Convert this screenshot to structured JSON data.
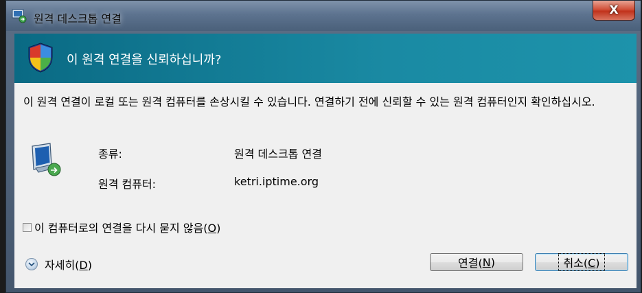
{
  "window": {
    "title": "원격 데스크톱 연결",
    "close_label": "X"
  },
  "header": {
    "question": "이 원격 연결을 신뢰하십니까?"
  },
  "body": {
    "description": "이 원격 연결이 로컬 또는 원격 컴퓨터를 손상시킬 수 있습니다. 연결하기 전에 신뢰할 수 있는 원격 컴퓨터인지 확인하십시오.",
    "info": [
      {
        "label": "종류:",
        "value": "원격 데스크톱 연결"
      },
      {
        "label": "원격 컴퓨터:",
        "value": "ketri.iptime.org"
      }
    ],
    "checkbox": {
      "label_before": "이 컴퓨터로의 연결을 다시 묻지 않음(",
      "access_key": "O",
      "label_after": ")",
      "checked": false
    },
    "details": {
      "label_before": "자세히(",
      "access_key": "D",
      "label_after": ")"
    }
  },
  "buttons": {
    "connect": {
      "label_before": "연결(",
      "access_key": "N",
      "label_after": ")"
    },
    "cancel": {
      "label_before": "취소(",
      "access_key": "C",
      "label_after": ")"
    }
  },
  "icons": {
    "title": "remote-desktop-icon",
    "header": "uac-shield-icon",
    "info": "remote-computer-icon",
    "details": "chevron-down-icon"
  }
}
